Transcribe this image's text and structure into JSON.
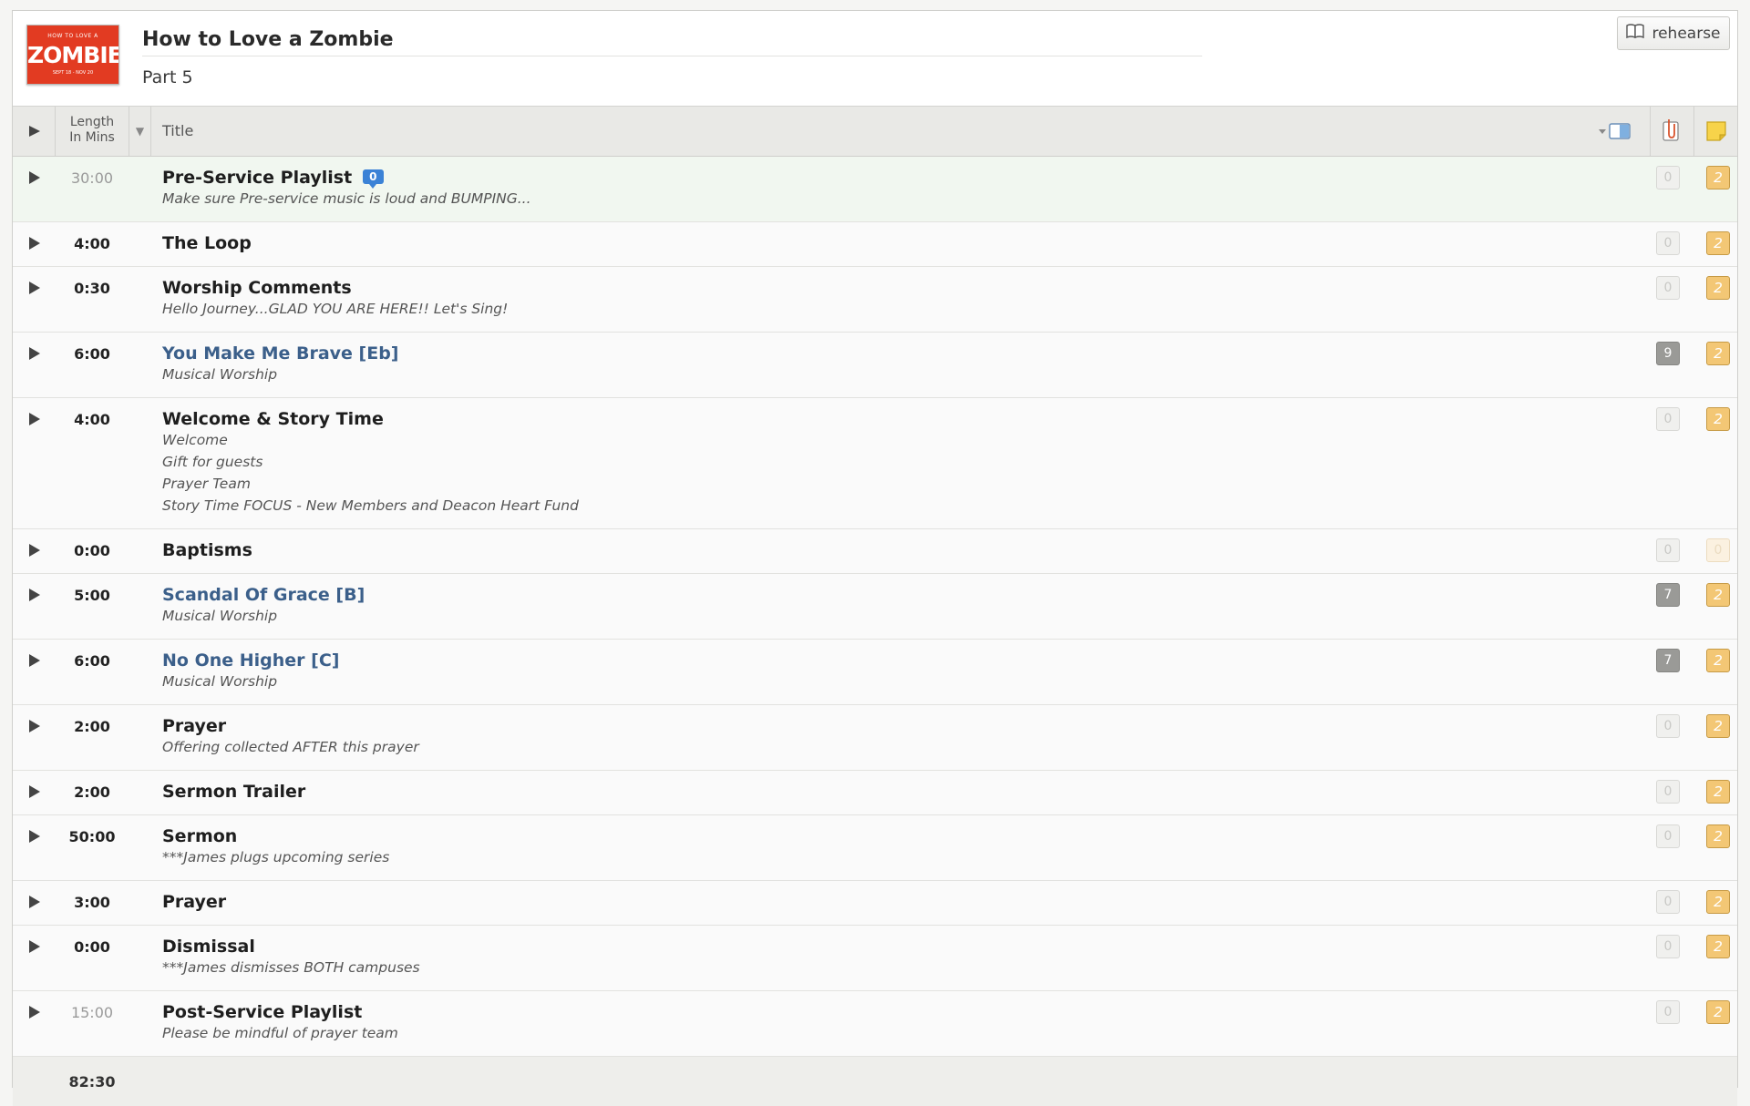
{
  "header": {
    "artwork": {
      "line1": "HOW TO LOVE A",
      "main": "ZOMBIE",
      "line3": "SEPT 18 - NOV 20"
    },
    "title": "How to Love a Zombie",
    "subtitle": "Part 5",
    "rehearse_label": "rehearse"
  },
  "columns": {
    "length_line1": "Length",
    "length_line2": "In Mins",
    "title": "Title"
  },
  "items": [
    {
      "length": "30:00",
      "length_muted": true,
      "title": "Pre-Service Playlist",
      "link": false,
      "bubble": "0",
      "notes": [
        "Make sure Pre-service music is loud and BUMPING..."
      ],
      "attachments": "0",
      "attachments_filled": false,
      "notes_count": "2",
      "notes_empty": false
    },
    {
      "length": "4:00",
      "length_muted": false,
      "title": "The Loop",
      "link": false,
      "bubble": "",
      "notes": [],
      "attachments": "0",
      "attachments_filled": false,
      "notes_count": "2",
      "notes_empty": false
    },
    {
      "length": "0:30",
      "length_muted": false,
      "title": "Worship Comments",
      "link": false,
      "bubble": "",
      "notes": [
        "Hello Journey...GLAD YOU ARE HERE!! Let's Sing!"
      ],
      "attachments": "0",
      "attachments_filled": false,
      "notes_count": "2",
      "notes_empty": false
    },
    {
      "length": "6:00",
      "length_muted": false,
      "title": "You Make Me Brave [Eb]",
      "link": true,
      "bubble": "",
      "notes": [
        "Musical Worship"
      ],
      "attachments": "9",
      "attachments_filled": true,
      "notes_count": "2",
      "notes_empty": false
    },
    {
      "length": "4:00",
      "length_muted": false,
      "title": "Welcome & Story Time",
      "link": false,
      "bubble": "",
      "notes": [
        "Welcome",
        "Gift for guests",
        "Prayer Team",
        "Story Time FOCUS - New Members and Deacon Heart Fund"
      ],
      "attachments": "0",
      "attachments_filled": false,
      "notes_count": "2",
      "notes_empty": false
    },
    {
      "length": "0:00",
      "length_muted": false,
      "title": "Baptisms",
      "link": false,
      "bubble": "",
      "notes": [],
      "attachments": "0",
      "attachments_filled": false,
      "notes_count": "0",
      "notes_empty": true
    },
    {
      "length": "5:00",
      "length_muted": false,
      "title": "Scandal Of Grace [B]",
      "link": true,
      "bubble": "",
      "notes": [
        "Musical Worship"
      ],
      "attachments": "7",
      "attachments_filled": true,
      "notes_count": "2",
      "notes_empty": false
    },
    {
      "length": "6:00",
      "length_muted": false,
      "title": "No One Higher [C]",
      "link": true,
      "bubble": "",
      "notes": [
        "Musical Worship"
      ],
      "attachments": "7",
      "attachments_filled": true,
      "notes_count": "2",
      "notes_empty": false
    },
    {
      "length": "2:00",
      "length_muted": false,
      "title": "Prayer",
      "link": false,
      "bubble": "",
      "notes": [
        "Offering collected AFTER this prayer"
      ],
      "attachments": "0",
      "attachments_filled": false,
      "notes_count": "2",
      "notes_empty": false
    },
    {
      "length": "2:00",
      "length_muted": false,
      "title": "Sermon Trailer",
      "link": false,
      "bubble": "",
      "notes": [],
      "attachments": "0",
      "attachments_filled": false,
      "notes_count": "2",
      "notes_empty": false
    },
    {
      "length": "50:00",
      "length_muted": false,
      "title": "Sermon",
      "link": false,
      "bubble": "",
      "notes": [
        "***James plugs upcoming series"
      ],
      "attachments": "0",
      "attachments_filled": false,
      "notes_count": "2",
      "notes_empty": false
    },
    {
      "length": "3:00",
      "length_muted": false,
      "title": "Prayer",
      "link": false,
      "bubble": "",
      "notes": [],
      "attachments": "0",
      "attachments_filled": false,
      "notes_count": "2",
      "notes_empty": false
    },
    {
      "length": "0:00",
      "length_muted": false,
      "title": "Dismissal",
      "link": false,
      "bubble": "",
      "notes": [
        "***James dismisses BOTH campuses"
      ],
      "attachments": "0",
      "attachments_filled": false,
      "notes_count": "2",
      "notes_empty": false
    },
    {
      "length": "15:00",
      "length_muted": true,
      "title": "Post-Service Playlist",
      "link": false,
      "bubble": "",
      "notes": [
        "Please be mindful of prayer team"
      ],
      "attachments": "0",
      "attachments_filled": false,
      "notes_count": "2",
      "notes_empty": false
    }
  ],
  "footer": {
    "total_length": "82:30"
  },
  "colors": {
    "link": "#3b5f8a",
    "bubble": "#3b82d6",
    "note_badge": "#f3c775",
    "highlight_row": "#f1f7f0"
  }
}
